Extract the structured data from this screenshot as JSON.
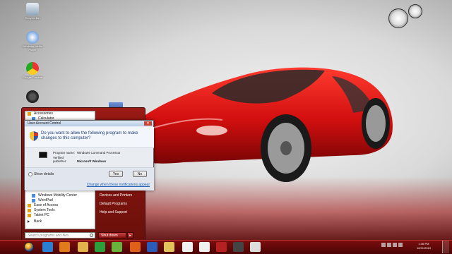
{
  "desktop": {
    "icons": [
      {
        "label": "Recycle Bin",
        "icon": "recycle-bin-icon"
      },
      {
        "label": "Windows Media Player",
        "icon": "media-player-icon"
      },
      {
        "label": "Google Chrome",
        "icon": "chrome-icon"
      },
      {
        "label": "Computer",
        "icon": "computer-icon"
      }
    ]
  },
  "start_menu": {
    "left_items": [
      {
        "label": "Accessories",
        "type": "folder"
      },
      {
        "label": "Calculator",
        "type": "sub"
      },
      {
        "label": "Windows Mobility Center",
        "type": "sub"
      },
      {
        "label": "WordPad",
        "type": "sub"
      },
      {
        "label": "Ease of Access",
        "type": "folder"
      },
      {
        "label": "System Tools",
        "type": "folder"
      },
      {
        "label": "Tablet PC",
        "type": "folder"
      },
      {
        "label": "Back",
        "type": "back"
      }
    ],
    "search_placeholder": "Search programs and files",
    "right_items": [
      "Devices and Printers",
      "Default Programs",
      "Help and Support"
    ],
    "shutdown_label": "Shut down",
    "shutdown_arrow": "▸"
  },
  "uac": {
    "title": "User Account Control",
    "close_label": "✕",
    "question": "Do you want to allow the following program to make changes to this computer?",
    "program_name_label": "Program name:",
    "program_name": "Windows Command Processor",
    "publisher_label": "Verified publisher:",
    "publisher": "Microsoft Windows",
    "show_details": "Show details",
    "yes": "Yes",
    "no": "No",
    "change_link": "Change when these notifications appear"
  },
  "taskbar": {
    "pinned": [
      {
        "icon": "internet-explorer-icon",
        "color": "#2a7fd4"
      },
      {
        "icon": "media-player-icon",
        "color": "#e07a1a"
      },
      {
        "icon": "file-explorer-icon",
        "color": "#e2b34a"
      },
      {
        "icon": "media-app-icon",
        "color": "#2e9c3a"
      },
      {
        "icon": "utorrent-icon",
        "color": "#6ab23d"
      },
      {
        "icon": "firefox-icon",
        "color": "#e0601a"
      },
      {
        "icon": "word-icon",
        "color": "#2a5cb6"
      },
      {
        "icon": "folder-icon",
        "color": "#e2c25a"
      },
      {
        "icon": "document-icon",
        "color": "#f0f0f0"
      },
      {
        "icon": "document-icon",
        "color": "#f0f0f0"
      },
      {
        "icon": "app-icon",
        "color": "#b52020"
      },
      {
        "icon": "media-icon",
        "color": "#444444"
      },
      {
        "icon": "window-icon",
        "color": "#dddddd"
      }
    ],
    "time": "1:36 PM",
    "date": "10/21/2019"
  }
}
